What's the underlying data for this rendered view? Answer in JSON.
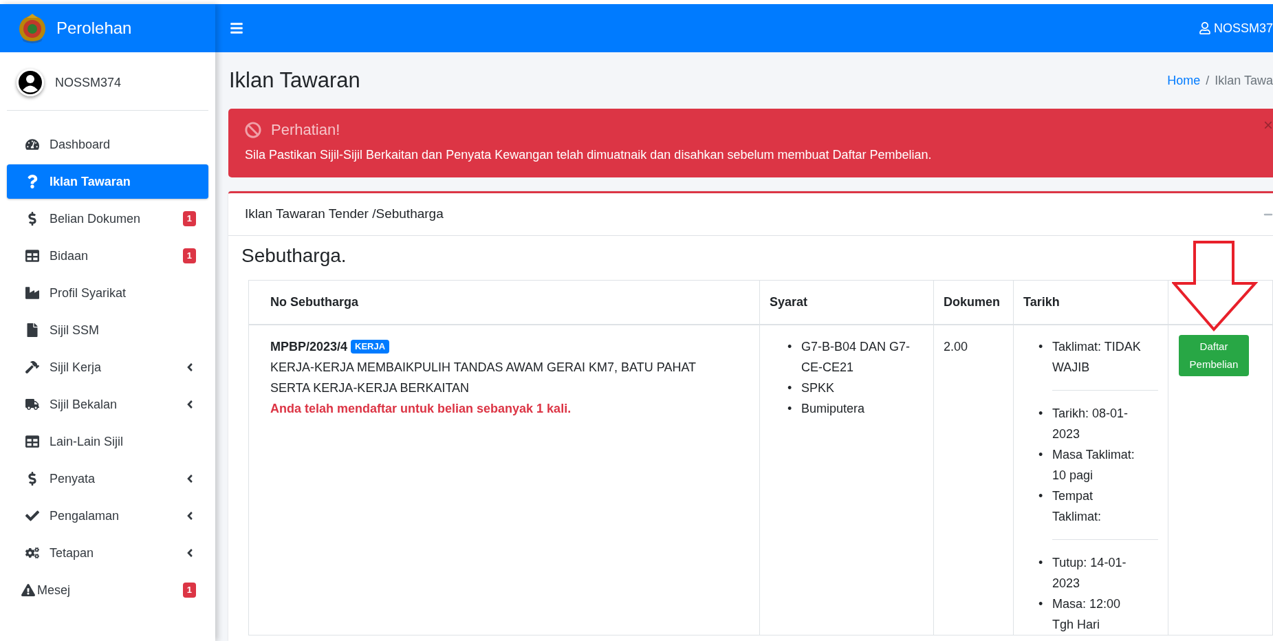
{
  "brand": {
    "title": "Perolehan"
  },
  "user": {
    "name": "NOSSM374"
  },
  "sidebar": {
    "items": [
      {
        "label": "Dashboard",
        "selected": false,
        "submenu": false
      },
      {
        "label": "Iklan Tawaran",
        "selected": true,
        "submenu": false
      },
      {
        "label": "Belian Dokumen",
        "selected": false,
        "submenu": false,
        "badge": "1"
      },
      {
        "label": "Bidaan",
        "selected": false,
        "submenu": false,
        "badge": "1"
      },
      {
        "label": "Profil Syarikat",
        "selected": false,
        "submenu": false
      },
      {
        "label": "Sijil SSM",
        "selected": false,
        "submenu": false
      },
      {
        "label": "Sijil Kerja",
        "selected": false,
        "submenu": true
      },
      {
        "label": "Sijil Bekalan",
        "selected": false,
        "submenu": true
      },
      {
        "label": "Lain-Lain Sijil",
        "selected": false,
        "submenu": false
      },
      {
        "label": "Penyata",
        "selected": false,
        "submenu": true
      },
      {
        "label": "Pengalaman",
        "selected": false,
        "submenu": true
      },
      {
        "label": "Tetapan",
        "selected": false,
        "submenu": true
      },
      {
        "label": "Mesej",
        "selected": false,
        "submenu": false,
        "badge": "1"
      }
    ]
  },
  "topbar": {
    "user_label": "NOSSM37"
  },
  "page": {
    "title": "Iklan Tawaran",
    "breadcrumb": [
      "Home",
      "Iklan Tawa"
    ],
    "breadcrumb_separator": "/"
  },
  "alert": {
    "title": "Perhatian!",
    "message": "Sila Pastikan Sijil-Sijil Berkaitan dan Penyata Kewangan telah dimuatnaik dan disahkan sebelum membuat Daftar Pembelian.",
    "close": "×"
  },
  "card": {
    "title": "Iklan Tawaran Tender /Sebutharga",
    "section_title": "Sebutharga.",
    "table": {
      "columns": [
        "No Sebutharga",
        "Syarat",
        "Dokumen",
        "Tarikh"
      ],
      "rows": [
        {
          "number": "MPBP/2023/4",
          "tag": "KERJA",
          "description": "KERJA-KERJA MEMBAIKPULIH TANDAS AWAM GERAI KM7, BATU PAHAT SERTA KERJA-KERJA BERKAITAN",
          "notice": "Anda telah mendaftar untuk belian sebanyak 1 kali.",
          "bullet": "•",
          "syarat": [
            "G7-B-B04 DAN G7-CE-CE21",
            "SPKK",
            "Bumiputera"
          ],
          "dokumen": "2.00",
          "tarikh": [
            [
              "Taklimat: TIDAK WAJIB"
            ],
            [
              "Tarikh: 08-01-2023",
              "Masa Taklimat: 10 pagi",
              "Tempat Taklimat:"
            ],
            [
              "Tutup: 14-01-2023",
              "Masa: 12:00 Tgh Hari"
            ]
          ],
          "action": "Daftar Pembelian"
        }
      ]
    }
  }
}
